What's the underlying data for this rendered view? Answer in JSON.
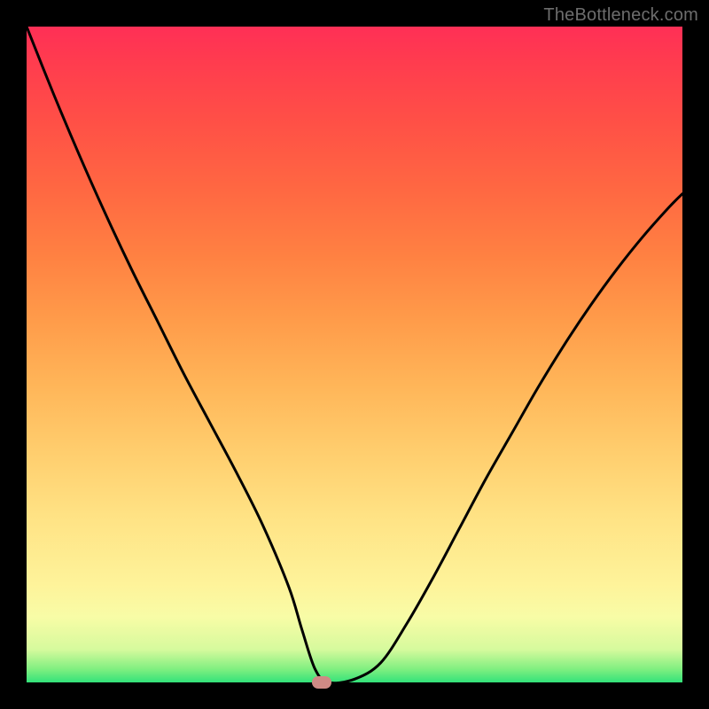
{
  "watermark": "TheBottleneck.com",
  "chart_data": {
    "type": "line",
    "title": "",
    "xlabel": "",
    "ylabel": "",
    "xlim": [
      0,
      100
    ],
    "ylim": [
      0,
      100
    ],
    "series": [
      {
        "name": "bottleneck-curve",
        "x": [
          0,
          4,
          8,
          12,
          16,
          20,
          24,
          28,
          32,
          36,
          40,
          42,
          44,
          46,
          50,
          54,
          58,
          62,
          66,
          70,
          74,
          78,
          82,
          86,
          90,
          94,
          98,
          100
        ],
        "y": [
          100,
          90,
          80.5,
          71.5,
          63,
          55,
          47,
          39.5,
          32,
          24,
          14.5,
          8,
          2,
          0,
          0.5,
          3,
          9,
          16,
          23.5,
          31,
          38,
          45,
          51.5,
          57.5,
          63,
          68,
          72.5,
          74.5
        ]
      }
    ],
    "marker": {
      "x": 45,
      "y": 0
    },
    "gradient_stops": [
      {
        "pct": 0,
        "color": "#33e27a"
      },
      {
        "pct": 2,
        "color": "#7fef80"
      },
      {
        "pct": 5,
        "color": "#d6fa9d"
      },
      {
        "pct": 10,
        "color": "#f8fca6"
      },
      {
        "pct": 15,
        "color": "#fef39a"
      },
      {
        "pct": 25,
        "color": "#ffe385"
      },
      {
        "pct": 35,
        "color": "#ffce6e"
      },
      {
        "pct": 45,
        "color": "#ffb659"
      },
      {
        "pct": 55,
        "color": "#ff9c4a"
      },
      {
        "pct": 65,
        "color": "#ff8142"
      },
      {
        "pct": 75,
        "color": "#ff6842"
      },
      {
        "pct": 85,
        "color": "#ff5146"
      },
      {
        "pct": 95,
        "color": "#ff3b4f"
      },
      {
        "pct": 100,
        "color": "#ff2f56"
      }
    ]
  }
}
